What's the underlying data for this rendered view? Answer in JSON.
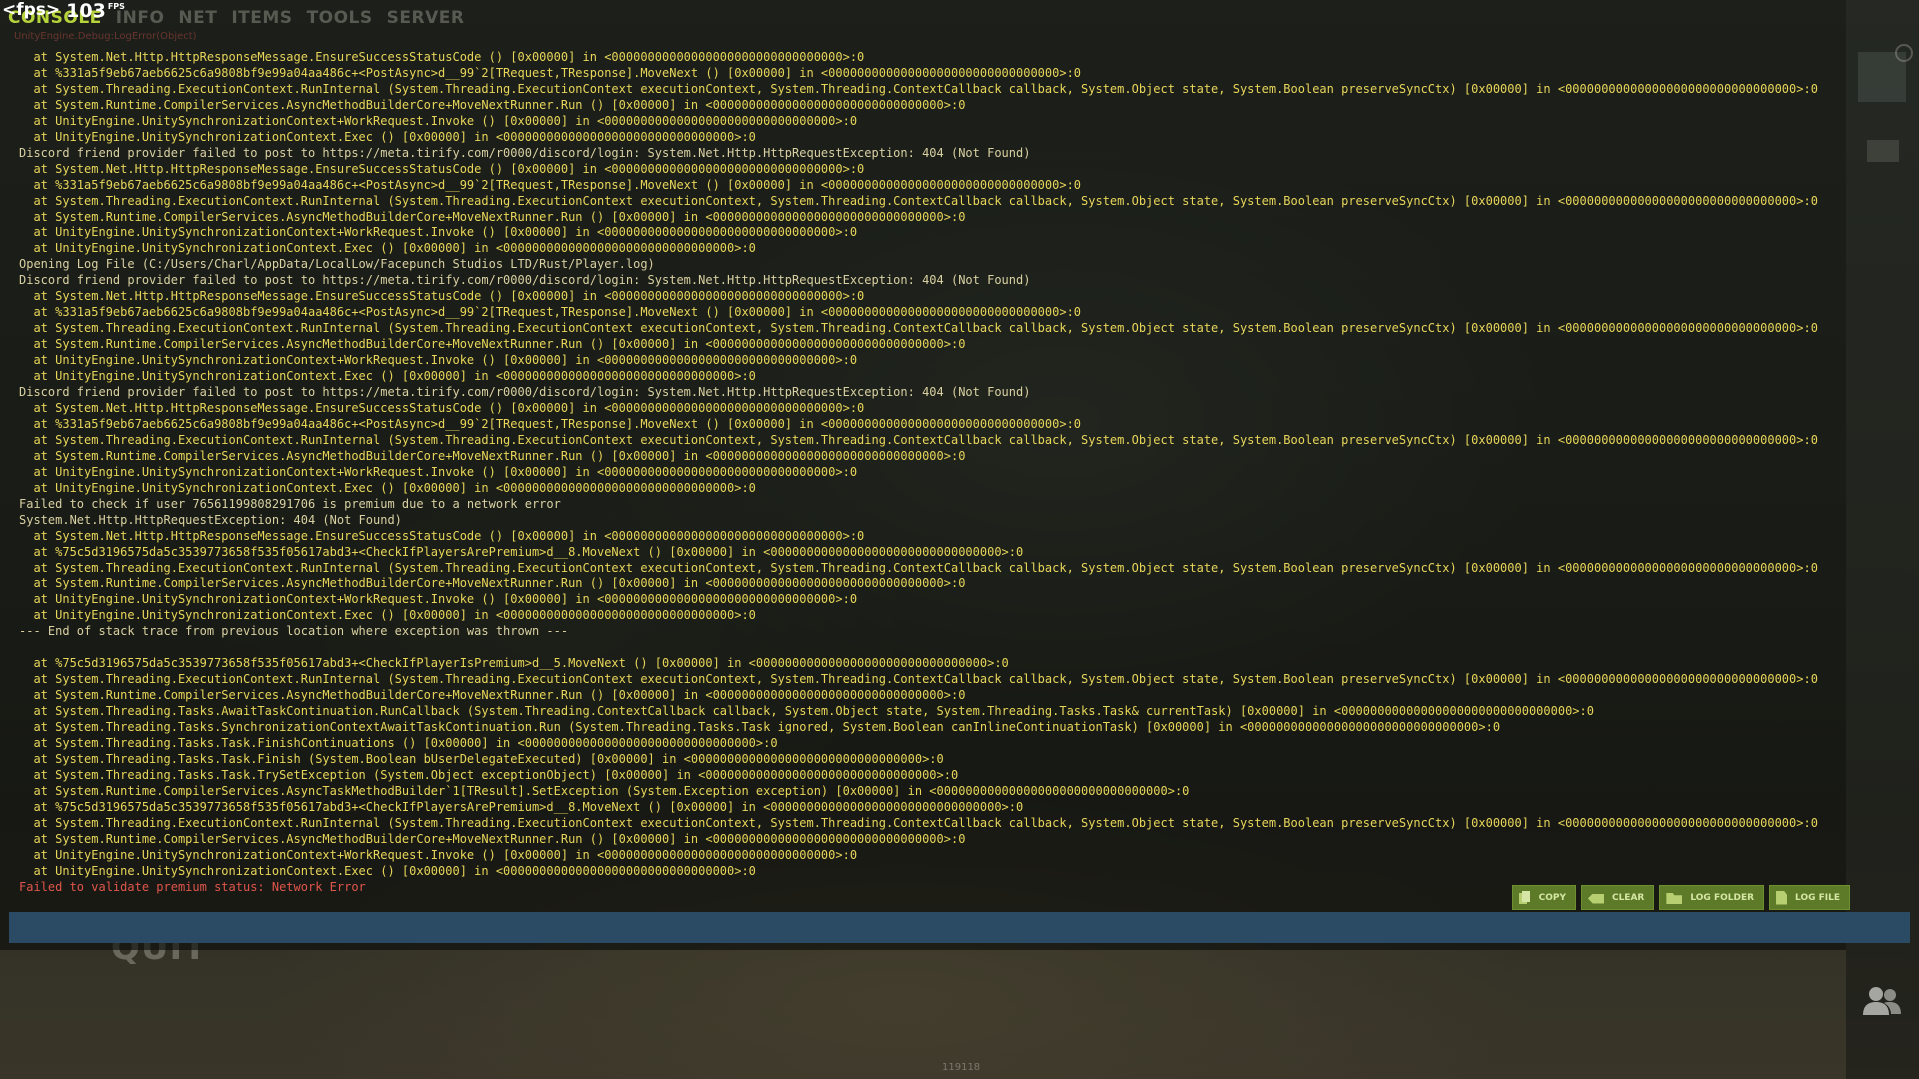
{
  "overlay_fps": {
    "tag": "<fps>",
    "value": "103",
    "unit": "FPS"
  },
  "tabs": [
    "CONSOLE",
    "INFO",
    "NET",
    "ITEMS",
    "TOOLS",
    "SERVER"
  ],
  "active_tab": "CONSOLE",
  "ghost_lines": [
    "UnityEngine.Debug:LogError(Object)"
  ],
  "log": [
    {
      "level": "trace",
      "text": "  at System.Net.Http.HttpResponseMessage.EnsureSuccessStatusCode () [0x00000] in <00000000000000000000000000000000>:0"
    },
    {
      "level": "trace",
      "text": "  at %331a5f9eb67aeb6625c6a9808bf9e99a04aa486c+<PostAsync>d__99`2[TRequest,TResponse].MoveNext () [0x00000] in <00000000000000000000000000000000>:0"
    },
    {
      "level": "trace",
      "text": "  at System.Threading.ExecutionContext.RunInternal (System.Threading.ExecutionContext executionContext, System.Threading.ContextCallback callback, System.Object state, System.Boolean preserveSyncCtx) [0x00000] in <00000000000000000000000000000000>:0"
    },
    {
      "level": "trace",
      "text": "  at System.Runtime.CompilerServices.AsyncMethodBuilderCore+MoveNextRunner.Run () [0x00000] in <00000000000000000000000000000000>:0"
    },
    {
      "level": "trace",
      "text": "  at UnityEngine.UnitySynchronizationContext+WorkRequest.Invoke () [0x00000] in <00000000000000000000000000000000>:0"
    },
    {
      "level": "trace",
      "text": "  at UnityEngine.UnitySynchronizationContext.Exec () [0x00000] in <00000000000000000000000000000000>:0"
    },
    {
      "level": "header",
      "text": "Discord friend provider failed to post to https://meta.tirify.com/r0000/discord/login: System.Net.Http.HttpRequestException: 404 (Not Found)"
    },
    {
      "level": "trace",
      "text": "  at System.Net.Http.HttpResponseMessage.EnsureSuccessStatusCode () [0x00000] in <00000000000000000000000000000000>:0"
    },
    {
      "level": "trace",
      "text": "  at %331a5f9eb67aeb6625c6a9808bf9e99a04aa486c+<PostAsync>d__99`2[TRequest,TResponse].MoveNext () [0x00000] in <00000000000000000000000000000000>:0"
    },
    {
      "level": "trace",
      "text": "  at System.Threading.ExecutionContext.RunInternal (System.Threading.ExecutionContext executionContext, System.Threading.ContextCallback callback, System.Object state, System.Boolean preserveSyncCtx) [0x00000] in <00000000000000000000000000000000>:0"
    },
    {
      "level": "trace",
      "text": "  at System.Runtime.CompilerServices.AsyncMethodBuilderCore+MoveNextRunner.Run () [0x00000] in <00000000000000000000000000000000>:0"
    },
    {
      "level": "trace",
      "text": "  at UnityEngine.UnitySynchronizationContext+WorkRequest.Invoke () [0x00000] in <00000000000000000000000000000000>:0"
    },
    {
      "level": "trace",
      "text": "  at UnityEngine.UnitySynchronizationContext.Exec () [0x00000] in <00000000000000000000000000000000>:0"
    },
    {
      "level": "header",
      "text": "Opening Log File (C:/Users/Charl/AppData/LocalLow/Facepunch Studios LTD/Rust/Player.log)"
    },
    {
      "level": "header",
      "text": "Discord friend provider failed to post to https://meta.tirify.com/r0000/discord/login: System.Net.Http.HttpRequestException: 404 (Not Found)"
    },
    {
      "level": "trace",
      "text": "  at System.Net.Http.HttpResponseMessage.EnsureSuccessStatusCode () [0x00000] in <00000000000000000000000000000000>:0"
    },
    {
      "level": "trace",
      "text": "  at %331a5f9eb67aeb6625c6a9808bf9e99a04aa486c+<PostAsync>d__99`2[TRequest,TResponse].MoveNext () [0x00000] in <00000000000000000000000000000000>:0"
    },
    {
      "level": "trace",
      "text": "  at System.Threading.ExecutionContext.RunInternal (System.Threading.ExecutionContext executionContext, System.Threading.ContextCallback callback, System.Object state, System.Boolean preserveSyncCtx) [0x00000] in <00000000000000000000000000000000>:0"
    },
    {
      "level": "trace",
      "text": "  at System.Runtime.CompilerServices.AsyncMethodBuilderCore+MoveNextRunner.Run () [0x00000] in <00000000000000000000000000000000>:0"
    },
    {
      "level": "trace",
      "text": "  at UnityEngine.UnitySynchronizationContext+WorkRequest.Invoke () [0x00000] in <00000000000000000000000000000000>:0"
    },
    {
      "level": "trace",
      "text": "  at UnityEngine.UnitySynchronizationContext.Exec () [0x00000] in <00000000000000000000000000000000>:0"
    },
    {
      "level": "header",
      "text": "Discord friend provider failed to post to https://meta.tirify.com/r0000/discord/login: System.Net.Http.HttpRequestException: 404 (Not Found)"
    },
    {
      "level": "trace",
      "text": "  at System.Net.Http.HttpResponseMessage.EnsureSuccessStatusCode () [0x00000] in <00000000000000000000000000000000>:0"
    },
    {
      "level": "trace",
      "text": "  at %331a5f9eb67aeb6625c6a9808bf9e99a04aa486c+<PostAsync>d__99`2[TRequest,TResponse].MoveNext () [0x00000] in <00000000000000000000000000000000>:0"
    },
    {
      "level": "trace",
      "text": "  at System.Threading.ExecutionContext.RunInternal (System.Threading.ExecutionContext executionContext, System.Threading.ContextCallback callback, System.Object state, System.Boolean preserveSyncCtx) [0x00000] in <00000000000000000000000000000000>:0"
    },
    {
      "level": "trace",
      "text": "  at System.Runtime.CompilerServices.AsyncMethodBuilderCore+MoveNextRunner.Run () [0x00000] in <00000000000000000000000000000000>:0"
    },
    {
      "level": "trace",
      "text": "  at UnityEngine.UnitySynchronizationContext+WorkRequest.Invoke () [0x00000] in <00000000000000000000000000000000>:0"
    },
    {
      "level": "trace",
      "text": "  at UnityEngine.UnitySynchronizationContext.Exec () [0x00000] in <00000000000000000000000000000000>:0"
    },
    {
      "level": "header",
      "text": "Failed to check if user 76561199808291706 is premium due to a network error"
    },
    {
      "level": "header",
      "text": "System.Net.Http.HttpRequestException: 404 (Not Found)"
    },
    {
      "level": "trace",
      "text": "  at System.Net.Http.HttpResponseMessage.EnsureSuccessStatusCode () [0x00000] in <00000000000000000000000000000000>:0"
    },
    {
      "level": "trace",
      "text": "  at %75c5d3196575da5c3539773658f535f05617abd3+<CheckIfPlayersArePremium>d__8.MoveNext () [0x00000] in <00000000000000000000000000000000>:0"
    },
    {
      "level": "trace",
      "text": "  at System.Threading.ExecutionContext.RunInternal (System.Threading.ExecutionContext executionContext, System.Threading.ContextCallback callback, System.Object state, System.Boolean preserveSyncCtx) [0x00000] in <00000000000000000000000000000000>:0"
    },
    {
      "level": "trace",
      "text": "  at System.Runtime.CompilerServices.AsyncMethodBuilderCore+MoveNextRunner.Run () [0x00000] in <00000000000000000000000000000000>:0"
    },
    {
      "level": "trace",
      "text": "  at UnityEngine.UnitySynchronizationContext+WorkRequest.Invoke () [0x00000] in <00000000000000000000000000000000>:0"
    },
    {
      "level": "trace",
      "text": "  at UnityEngine.UnitySynchronizationContext.Exec () [0x00000] in <00000000000000000000000000000000>:0"
    },
    {
      "level": "header",
      "text": "--- End of stack trace from previous location where exception was thrown ---"
    },
    {
      "level": "blank",
      "text": ""
    },
    {
      "level": "trace",
      "text": "  at %75c5d3196575da5c3539773658f535f05617abd3+<CheckIfPlayerIsPremium>d__5.MoveNext () [0x00000] in <00000000000000000000000000000000>:0"
    },
    {
      "level": "trace",
      "text": "  at System.Threading.ExecutionContext.RunInternal (System.Threading.ExecutionContext executionContext, System.Threading.ContextCallback callback, System.Object state, System.Boolean preserveSyncCtx) [0x00000] in <00000000000000000000000000000000>:0"
    },
    {
      "level": "trace",
      "text": "  at System.Runtime.CompilerServices.AsyncMethodBuilderCore+MoveNextRunner.Run () [0x00000] in <00000000000000000000000000000000>:0"
    },
    {
      "level": "trace",
      "text": "  at System.Threading.Tasks.AwaitTaskContinuation.RunCallback (System.Threading.ContextCallback callback, System.Object state, System.Threading.Tasks.Task& currentTask) [0x00000] in <00000000000000000000000000000000>:0"
    },
    {
      "level": "trace",
      "text": "  at System.Threading.Tasks.SynchronizationContextAwaitTaskContinuation.Run (System.Threading.Tasks.Task ignored, System.Boolean canInlineContinuationTask) [0x00000] in <00000000000000000000000000000000>:0"
    },
    {
      "level": "trace",
      "text": "  at System.Threading.Tasks.Task.FinishContinuations () [0x00000] in <00000000000000000000000000000000>:0"
    },
    {
      "level": "trace",
      "text": "  at System.Threading.Tasks.Task.Finish (System.Boolean bUserDelegateExecuted) [0x00000] in <00000000000000000000000000000000>:0"
    },
    {
      "level": "trace",
      "text": "  at System.Threading.Tasks.Task.TrySetException (System.Object exceptionObject) [0x00000] in <00000000000000000000000000000000>:0"
    },
    {
      "level": "trace",
      "text": "  at System.Runtime.CompilerServices.AsyncTaskMethodBuilder`1[TResult].SetException (System.Exception exception) [0x00000] in <00000000000000000000000000000000>:0"
    },
    {
      "level": "trace",
      "text": "  at %75c5d3196575da5c3539773658f535f05617abd3+<CheckIfPlayersArePremium>d__8.MoveNext () [0x00000] in <00000000000000000000000000000000>:0"
    },
    {
      "level": "trace",
      "text": "  at System.Threading.ExecutionContext.RunInternal (System.Threading.ExecutionContext executionContext, System.Threading.ContextCallback callback, System.Object state, System.Boolean preserveSyncCtx) [0x00000] in <00000000000000000000000000000000>:0"
    },
    {
      "level": "trace",
      "text": "  at System.Runtime.CompilerServices.AsyncMethodBuilderCore+MoveNextRunner.Run () [0x00000] in <00000000000000000000000000000000>:0"
    },
    {
      "level": "trace",
      "text": "  at UnityEngine.UnitySynchronizationContext+WorkRequest.Invoke () [0x00000] in <00000000000000000000000000000000>:0"
    },
    {
      "level": "trace",
      "text": "  at UnityEngine.UnitySynchronizationContext.Exec () [0x00000] in <00000000000000000000000000000000>:0"
    },
    {
      "level": "error",
      "text": "Failed to validate premium status: Network Error"
    }
  ],
  "buttons": {
    "copy": {
      "label": "COPY",
      "icon": "copy-icon"
    },
    "clear": {
      "label": "CLEAR",
      "icon": "clear-icon"
    },
    "log_folder": {
      "label": "LOG FOLDER",
      "icon": "folder-icon"
    },
    "log_file": {
      "label": "LOG FILE",
      "icon": "file-icon"
    }
  },
  "console_input": {
    "value": "",
    "placeholder": ""
  },
  "background_menu": {
    "quit_label": "QUIT",
    "build_label": "119118"
  },
  "colors": {
    "accent": "#b5d33a",
    "log_trace": "#e8d65a",
    "log_header": "#d9d1a2",
    "log_error": "#e0554b",
    "button_bg": "#5c7a27",
    "input_bg": "#2b4a63"
  }
}
